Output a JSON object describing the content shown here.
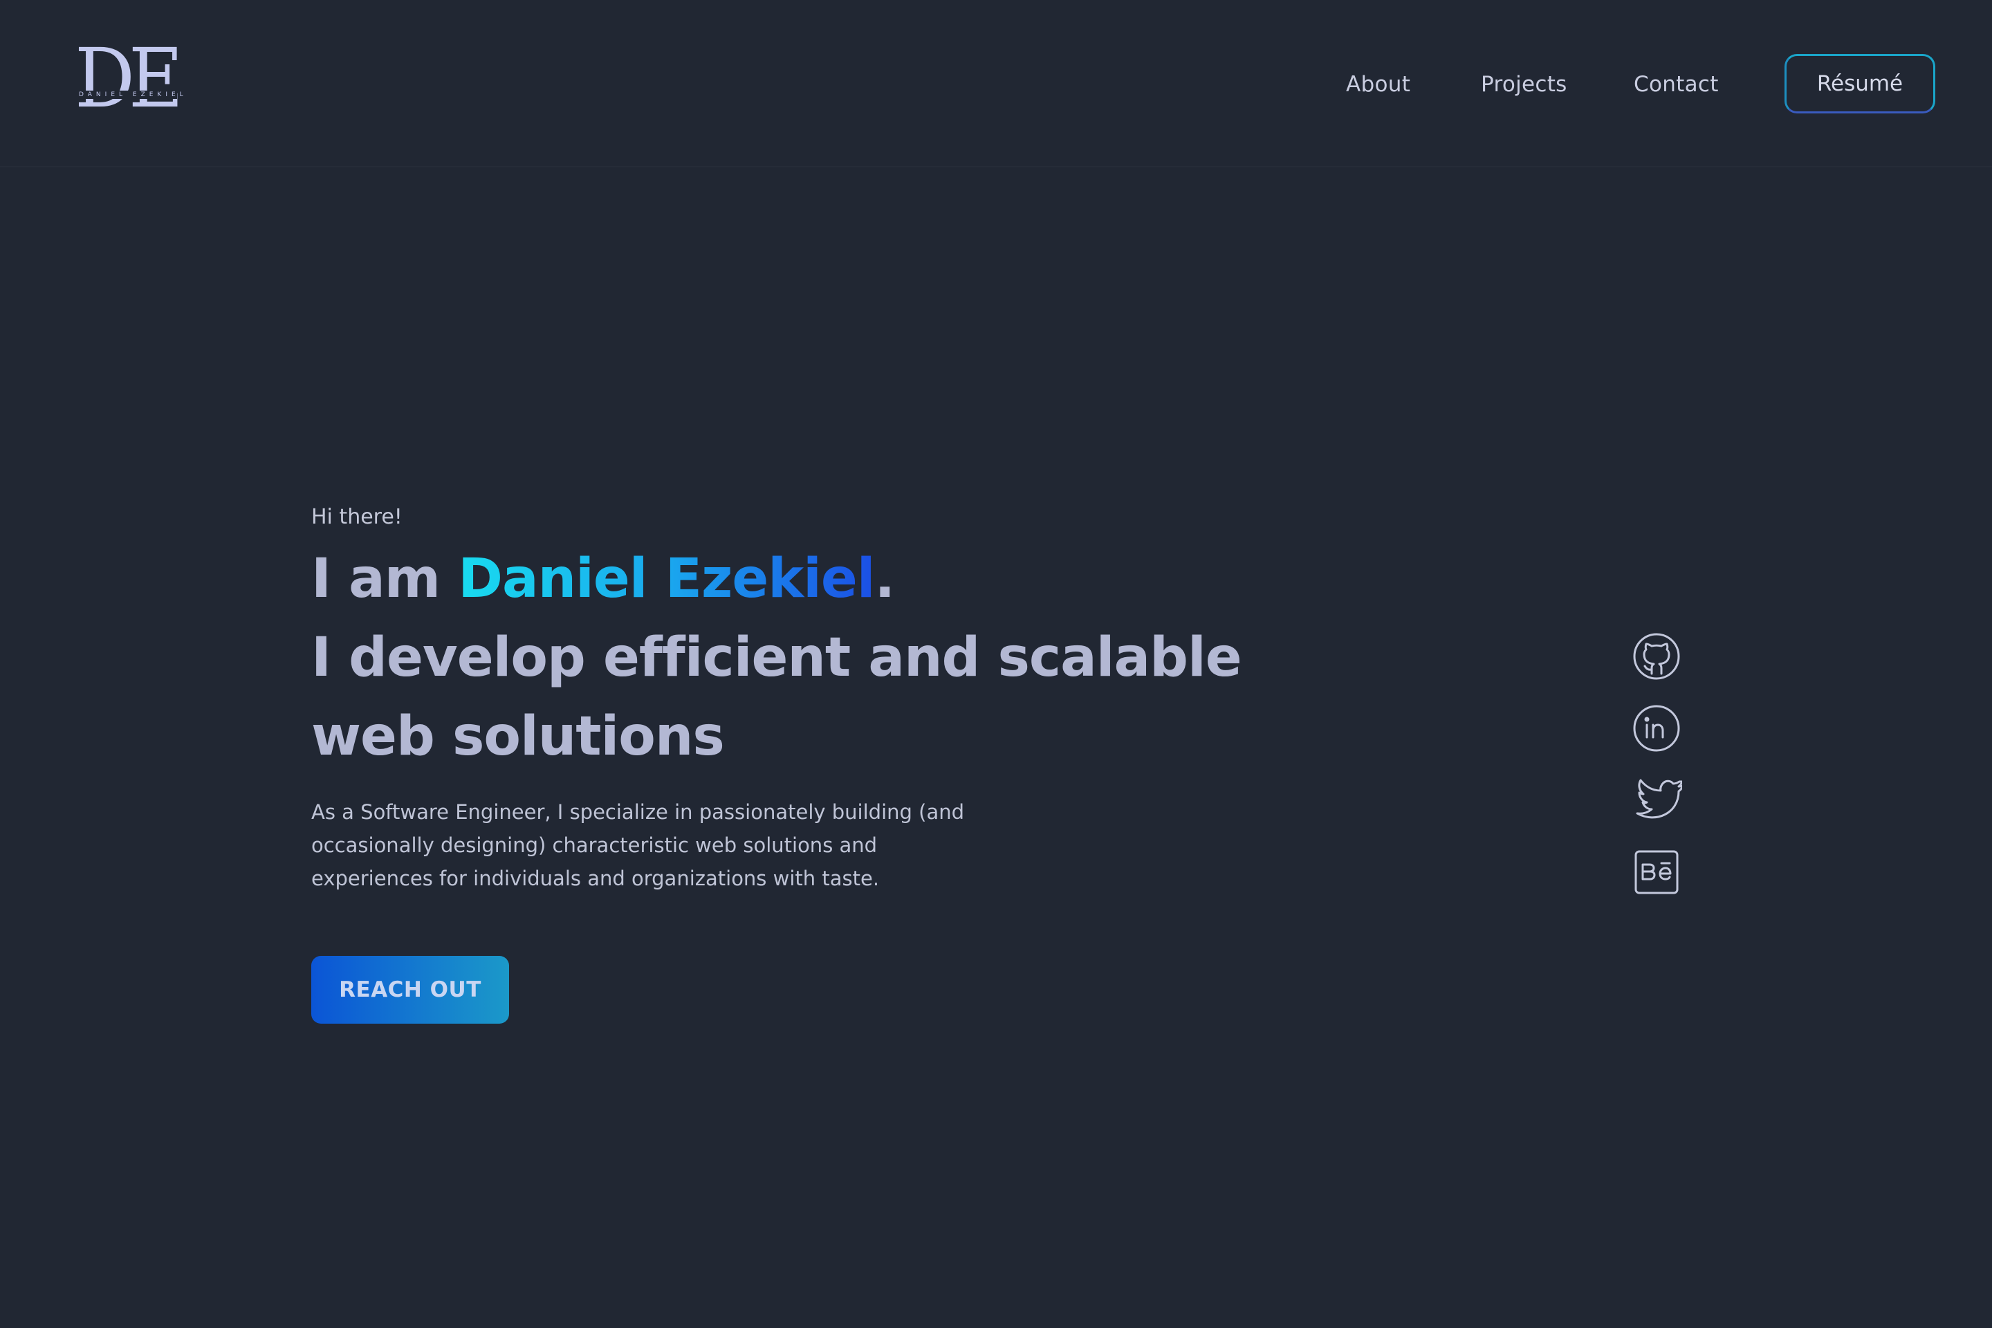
{
  "header": {
    "logo": {
      "letters": "DE",
      "subtitle": "DANIEL EZEKIEL"
    },
    "nav": [
      {
        "label": "About"
      },
      {
        "label": "Projects"
      },
      {
        "label": "Contact"
      }
    ],
    "resume_label": "Résumé"
  },
  "hero": {
    "greeting": "Hi there!",
    "headline_prefix": "I am ",
    "name": "Daniel Ezekiel",
    "name_suffix": ".",
    "tagline_line1": "I develop efficient and scalable",
    "tagline_line2": "web solutions",
    "intro": "As a Software Engineer, I specialize in passionately building (and occasionally designing) characteristic web solutions and experiences for individuals and organizations with taste.",
    "cta_label": "REACH OUT"
  },
  "social": [
    {
      "icon": "github-icon"
    },
    {
      "icon": "linkedin-icon"
    },
    {
      "icon": "twitter-icon"
    },
    {
      "icon": "behance-icon"
    }
  ],
  "colors": {
    "background": "#212733",
    "text": "#b3b8d3",
    "name_gradient_start": "#19dbef",
    "name_gradient_end": "#1b4fe6",
    "cta_gradient_start": "#0b55d6",
    "cta_gradient_end": "#1b99c9",
    "resume_border": "#1aa5c9"
  }
}
